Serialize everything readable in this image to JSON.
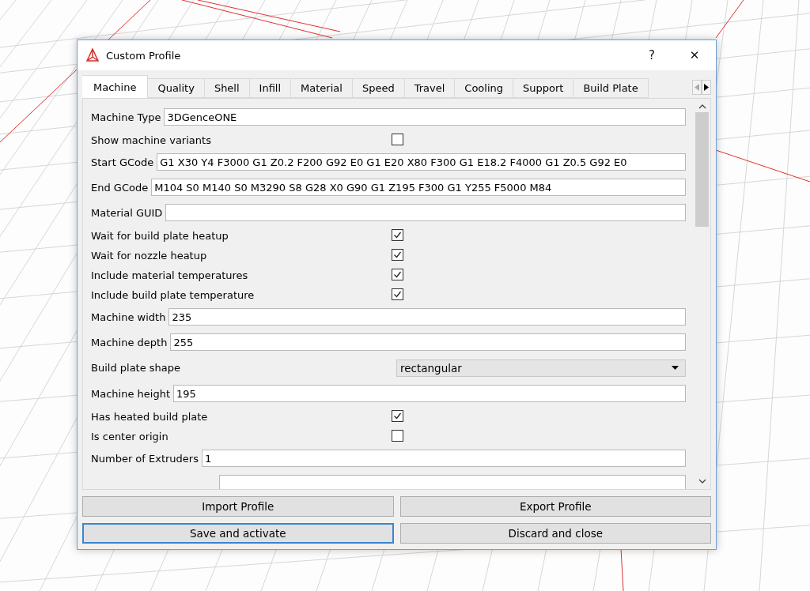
{
  "window": {
    "title": "Custom Profile",
    "help": "?",
    "close": "✕"
  },
  "tabs": [
    {
      "label": "Machine",
      "selected": true
    },
    {
      "label": "Quality",
      "selected": false
    },
    {
      "label": "Shell",
      "selected": false
    },
    {
      "label": "Infill",
      "selected": false
    },
    {
      "label": "Material",
      "selected": false
    },
    {
      "label": "Speed",
      "selected": false
    },
    {
      "label": "Travel",
      "selected": false
    },
    {
      "label": "Cooling",
      "selected": false
    },
    {
      "label": "Support",
      "selected": false
    },
    {
      "label": "Build Plate",
      "selected": false
    }
  ],
  "settings": [
    {
      "kind": "text",
      "label": "Machine Type",
      "value": "3DGenceONE"
    },
    {
      "kind": "checkbox",
      "label": "Show machine variants",
      "checked": false
    },
    {
      "kind": "text",
      "label": "Start GCode",
      "value": "G1 X30 Y4 F3000 G1 Z0.2 F200 G92 E0 G1 E20 X80 F300 G1 E18.2 F4000 G1 Z0.5 G92 E0"
    },
    {
      "kind": "text",
      "label": "End GCode",
      "value": "M104 S0 M140 S0 M3290 S8 G28 X0 G90 G1 Z195 F300 G1 Y255 F5000 M84"
    },
    {
      "kind": "text",
      "label": "Material GUID"
    },
    {
      "kind": "checkbox",
      "label": "Wait for build plate heatup",
      "checked": true
    },
    {
      "kind": "checkbox",
      "label": "Wait for nozzle heatup",
      "checked": true
    },
    {
      "kind": "checkbox",
      "label": "Include material temperatures",
      "checked": true
    },
    {
      "kind": "checkbox",
      "label": "Include build plate temperature",
      "checked": true
    },
    {
      "kind": "text",
      "label": "Machine width",
      "value": "235"
    },
    {
      "kind": "text",
      "label": "Machine depth",
      "value": "255"
    },
    {
      "kind": "select",
      "label": "Build plate shape",
      "value": "rectangular"
    },
    {
      "kind": "text",
      "label": "Machine height",
      "value": "195"
    },
    {
      "kind": "checkbox",
      "label": "Has heated build plate",
      "checked": true
    },
    {
      "kind": "checkbox",
      "label": "Is center origin",
      "checked": false
    },
    {
      "kind": "text",
      "label": "Number of Extruders",
      "value": "1"
    },
    {
      "kind": "text"
    }
  ],
  "buttons": [
    {
      "label": "Import Profile",
      "selected": false
    },
    {
      "label": "Export Profile",
      "selected": false
    },
    {
      "label": "Save and activate",
      "selected": true
    },
    {
      "label": "Discard and close",
      "selected": false
    }
  ]
}
